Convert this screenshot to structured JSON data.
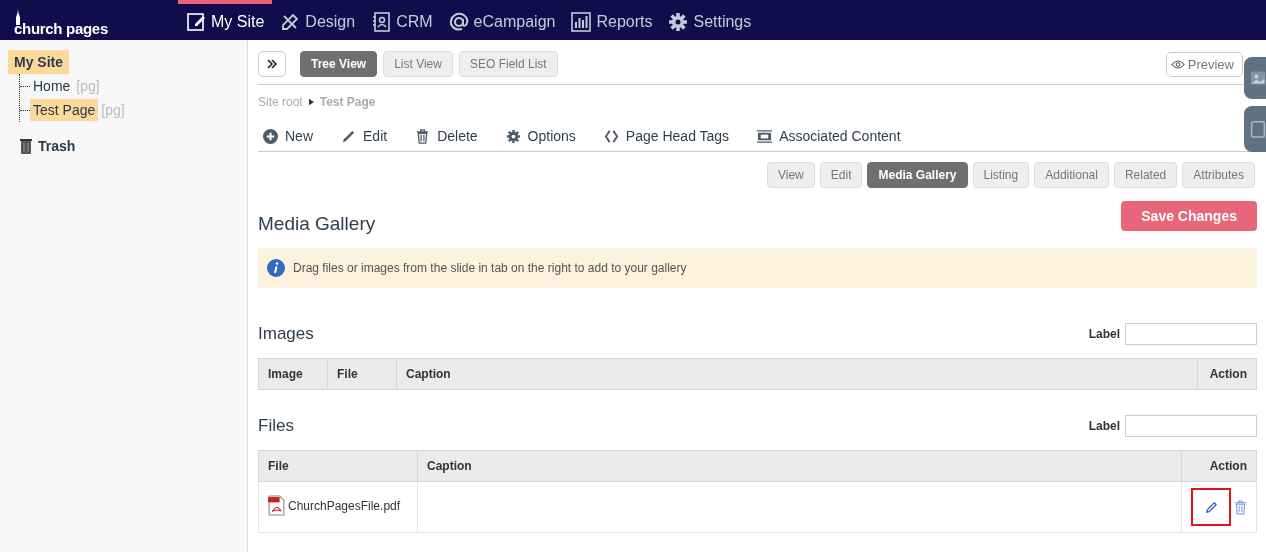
{
  "brand": "church pages",
  "nav": [
    {
      "label": "My Site",
      "kind": "site",
      "selected": true
    },
    {
      "label": "Design",
      "kind": "design",
      "selected": false
    },
    {
      "label": "CRM",
      "kind": "crm",
      "selected": false
    },
    {
      "label": "eCampaign",
      "kind": "at",
      "selected": false
    },
    {
      "label": "Reports",
      "kind": "chart",
      "selected": false
    },
    {
      "label": "Settings",
      "kind": "gear",
      "selected": false
    }
  ],
  "tree": {
    "label": "My Site",
    "selected": true,
    "children": [
      {
        "label": "Home",
        "tag": "[pg]",
        "selected": false
      },
      {
        "label": "Test Page",
        "tag": "[pg]",
        "selected": true
      }
    ]
  },
  "trash": "Trash",
  "view_tabs": [
    {
      "label": "Tree View",
      "selected": true
    },
    {
      "label": "List View",
      "selected": false
    },
    {
      "label": "SEO Field List",
      "selected": false
    }
  ],
  "preview": "Preview",
  "breadcrumb": [
    "Site root",
    "Test Page"
  ],
  "actions": [
    {
      "label": "New",
      "kind": "plus"
    },
    {
      "label": "Edit",
      "kind": "pencil"
    },
    {
      "label": "Delete",
      "kind": "trash"
    },
    {
      "label": "Options",
      "kind": "gear"
    },
    {
      "label": "Page Head Tags",
      "kind": "code"
    },
    {
      "label": "Associated Content",
      "kind": "content"
    }
  ],
  "page_tabs": [
    {
      "label": "View",
      "selected": false
    },
    {
      "label": "Edit",
      "selected": false
    },
    {
      "label": "Media Gallery",
      "selected": true
    },
    {
      "label": "Listing",
      "selected": false
    },
    {
      "label": "Additional",
      "selected": false
    },
    {
      "label": "Related",
      "selected": false
    },
    {
      "label": "Attributes",
      "selected": false
    }
  ],
  "heading": "Media Gallery",
  "save": "Save Changes",
  "notice": "Drag files or images from the slide in tab on the right to add to your gallery",
  "images": {
    "title": "Images",
    "label": "Label",
    "columns": [
      "Image",
      "File",
      "Caption",
      "Action"
    ]
  },
  "files": {
    "title": "Files",
    "label": "Label",
    "columns": [
      "File",
      "Caption",
      "Action"
    ],
    "rows": [
      {
        "file": "ChurchPagesFile.pdf"
      }
    ]
  }
}
